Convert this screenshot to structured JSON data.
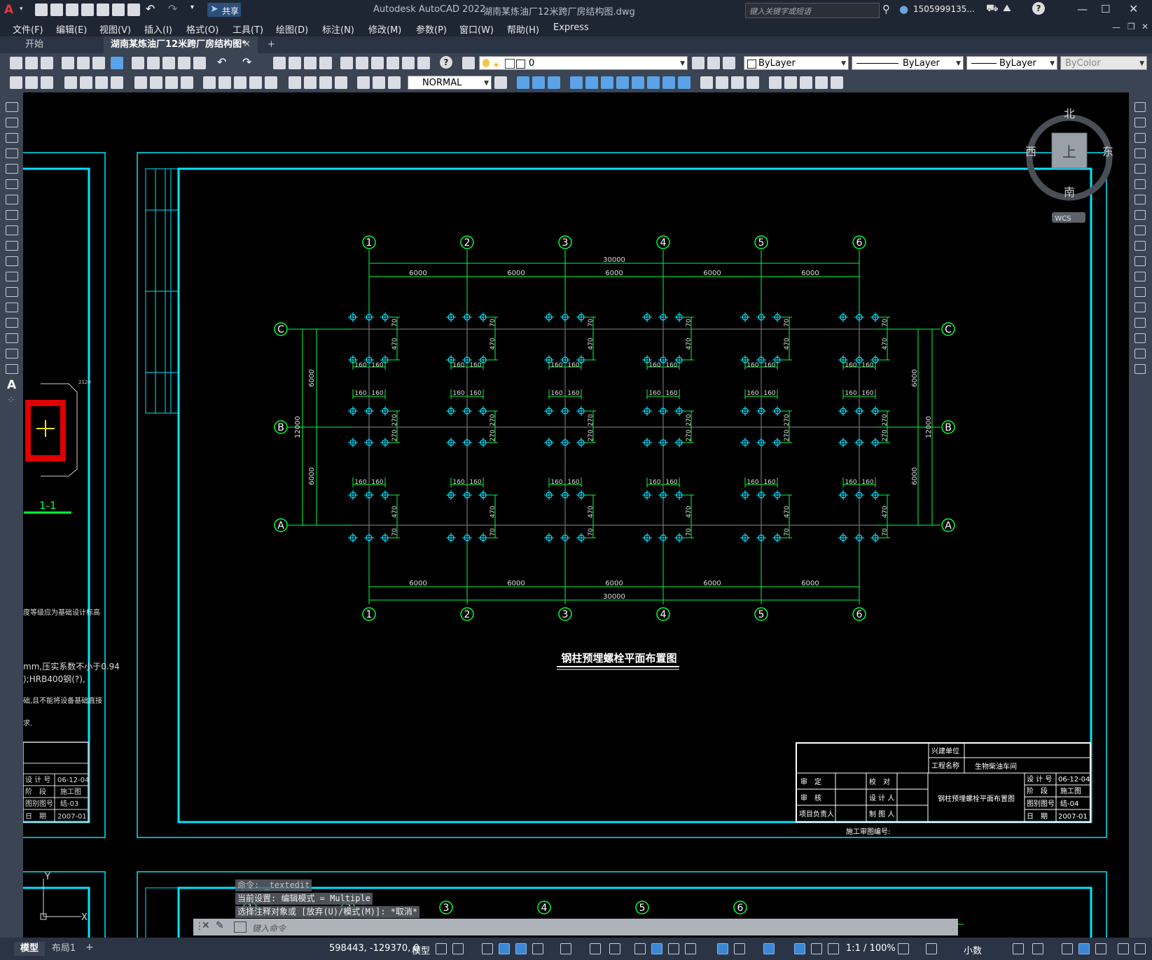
{
  "app": {
    "title": "Autodesk AutoCAD 2022",
    "filename": "湖南某炼油厂12米跨厂房结构图.dwg",
    "share_label": "共享",
    "search_placeholder": "键入关键字或短语",
    "user": "1505999135...",
    "logo_letter": "A"
  },
  "menu": [
    "文件(F)",
    "编辑(E)",
    "视图(V)",
    "插入(I)",
    "格式(O)",
    "工具(T)",
    "绘图(D)",
    "标注(N)",
    "修改(M)",
    "参数(P)",
    "窗口(W)",
    "帮助(H)",
    "Express"
  ],
  "tabs": [
    {
      "label": "开始"
    },
    {
      "label": "湖南某炼油厂12米跨厂房结构图*",
      "close": "✕"
    }
  ],
  "tab_add": "+",
  "toolbar": {
    "layer_value": "0",
    "color_value": "ByLayer",
    "linetype_value": "ByLayer",
    "lineweight_value": "ByLayer",
    "plotstyle_value": "ByColor",
    "dimstyle_value": "NORMAL"
  },
  "viewcube": {
    "north": "北",
    "south": "南",
    "east": "东",
    "west": "西",
    "face": "上",
    "wcs": "WCS"
  },
  "drawing": {
    "title": "钢柱预埋螺栓平面布置图",
    "axis_numbers": [
      "1",
      "2",
      "3",
      "4",
      "5",
      "6"
    ],
    "axis_letters": [
      "C",
      "B",
      "A"
    ],
    "total_width": "30000",
    "bay": "6000",
    "total_depth": "12000",
    "half_depth": "6000",
    "dim_160": "160",
    "dim_70": "70",
    "dim_470": "470",
    "dim_270": "270",
    "section_label": "1-1",
    "left_note_1": "度等级应为基础设计标高",
    "left_note_2": "mm,压实系数不小于0.94",
    "left_note_3": ");HRB400钢(?),",
    "left_note_4": "础,且不能将设备基础直接",
    "left_note_5": "求.",
    "approval_no_label": "施工审图编号:",
    "left_cross_label": "2120"
  },
  "titleblock": {
    "construction_unit_label": "兴建单位",
    "project_name_label": "工程名称",
    "project_name": "生物柴油车间",
    "rows": [
      {
        "a": "审　定",
        "b": "校　对"
      },
      {
        "a": "审　核",
        "b": "设 计 人"
      },
      {
        "a": "项目负责人",
        "b": "制 图 人"
      }
    ],
    "sheet_title": "钢柱预埋螺栓平面布置图",
    "info": [
      {
        "k": "设 计 号",
        "v": "06-12-04"
      },
      {
        "k": "阶　段",
        "v": "施工图"
      },
      {
        "k": "图别图号",
        "v": "结-04"
      },
      {
        "k": "日　期",
        "v": "2007-01"
      }
    ],
    "left_info": [
      {
        "k": "设 计 号",
        "v": "06-12-04"
      },
      {
        "k": "阶　段",
        "v": "施工图"
      },
      {
        "k": "图别图号",
        "v": "结-03"
      },
      {
        "k": "日　期",
        "v": "2007-01"
      }
    ]
  },
  "command": {
    "history": [
      "命令: _textedit",
      "当前设置: 编辑模式 = Multiple",
      "选择注释对象或 [放弃(U)/模式(M)]: *取消*"
    ],
    "placeholder": "键入命令"
  },
  "status": {
    "model_tab": "模型",
    "layout_tab": "布局1",
    "add": "+",
    "coords": "598443, -129370, 0",
    "space": "模型",
    "scale": "1:1 / 100%",
    "units": "小数"
  },
  "colors": {
    "cyan": "#00e5ff",
    "green": "#00ff3c",
    "bg": "#000000",
    "chrome": "#3b4453"
  }
}
